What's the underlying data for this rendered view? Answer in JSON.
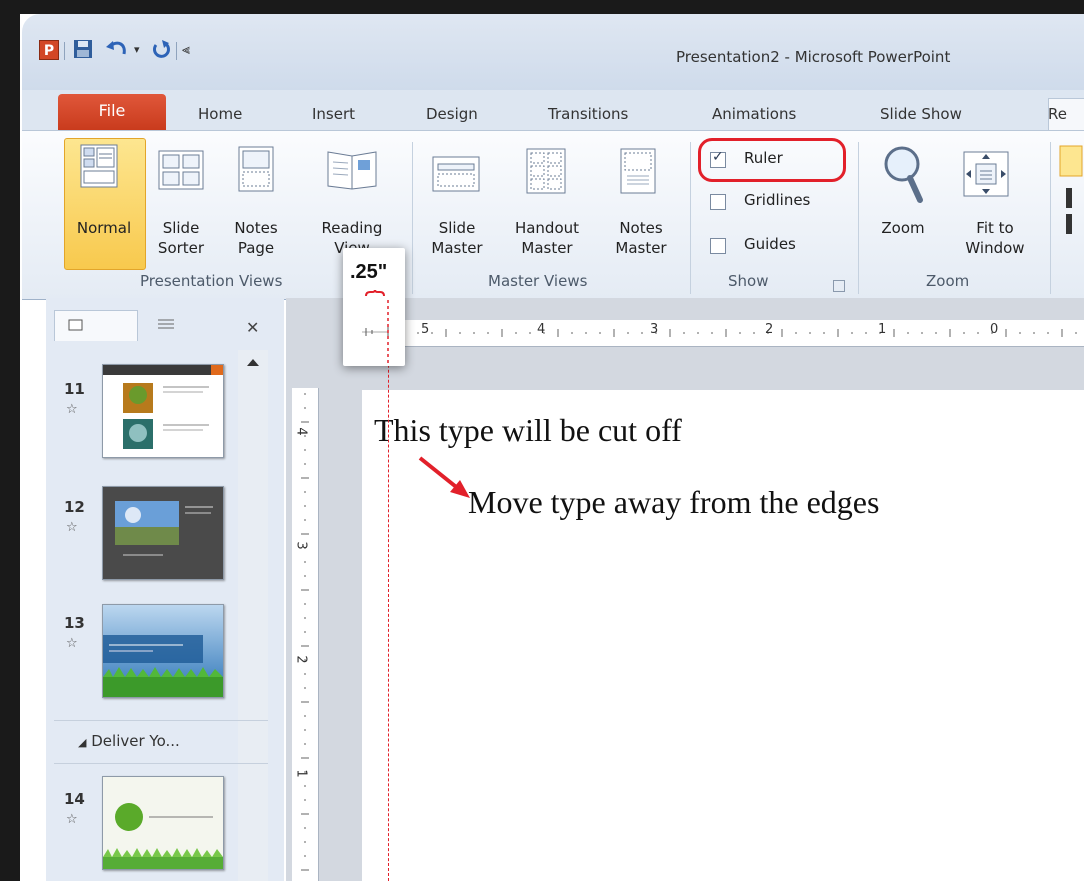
{
  "window": {
    "title": "Presentation2 - Microsoft PowerPoint"
  },
  "tabs": [
    {
      "label": "File"
    },
    {
      "label": "Home"
    },
    {
      "label": "Insert"
    },
    {
      "label": "Design"
    },
    {
      "label": "Transitions"
    },
    {
      "label": "Animations"
    },
    {
      "label": "Slide Show"
    },
    {
      "label": "Re"
    }
  ],
  "ribbon": {
    "presentation_views": {
      "label": "Presentation Views",
      "buttons": [
        {
          "l1": "Normal",
          "l2": ""
        },
        {
          "l1": "Slide",
          "l2": "Sorter"
        },
        {
          "l1": "Notes",
          "l2": "Page"
        },
        {
          "l1": "Reading",
          "l2": "View"
        }
      ]
    },
    "master_views": {
      "label": "Master Views",
      "buttons": [
        {
          "l1": "Slide",
          "l2": "Master"
        },
        {
          "l1": "Handout",
          "l2": "Master"
        },
        {
          "l1": "Notes",
          "l2": "Master"
        }
      ]
    },
    "show": {
      "label": "Show",
      "ruler": {
        "label": "Ruler",
        "checked": true
      },
      "gridlines": {
        "label": "Gridlines",
        "checked": false
      },
      "guides": {
        "label": "Guides",
        "checked": false
      }
    },
    "zoom": {
      "label": "Zoom",
      "buttons": [
        {
          "l1": "Zoom",
          "l2": ""
        },
        {
          "l1": "Fit to",
          "l2": "Window"
        }
      ]
    }
  },
  "rulers": {
    "horizontal_labels": [
      "5",
      "4",
      "3",
      "2",
      "1",
      "0"
    ],
    "vertical_labels": [
      "4",
      "3",
      "2",
      "1"
    ]
  },
  "magnifier": {
    "text": ".25\""
  },
  "slides_panel": {
    "slides": [
      {
        "number": "11"
      },
      {
        "number": "12"
      },
      {
        "number": "13"
      },
      {
        "number": "14"
      }
    ],
    "section": "Deliver Yo..."
  },
  "slide": {
    "line1": "This  type will be cut off",
    "line2": "Move type away from the edges"
  },
  "colors": {
    "annotation_red": "#e2202a",
    "file_tab": "#d24726",
    "normal_highlight": "#f8c94d"
  }
}
